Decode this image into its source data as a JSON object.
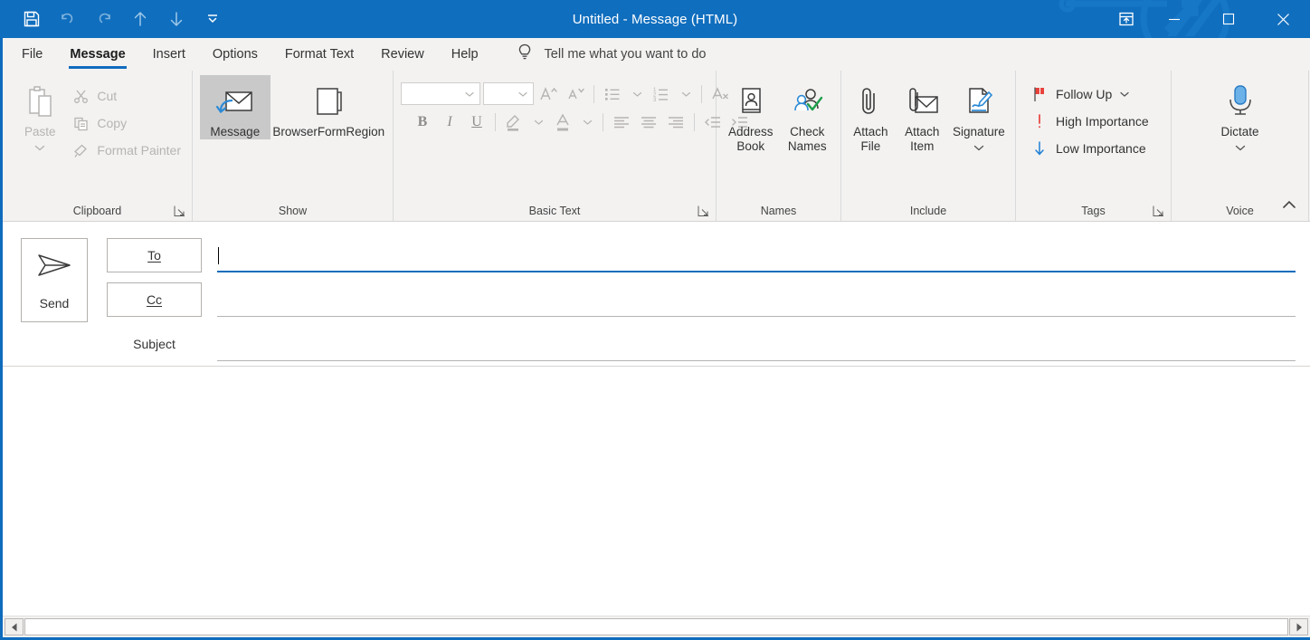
{
  "window": {
    "title": "Untitled  -  Message (HTML)",
    "accent_color": "#106ebe",
    "ribbon_bg": "#f3f2f1"
  },
  "quick_access": {
    "items": [
      {
        "name": "save-icon",
        "label": "Save",
        "disabled": false
      },
      {
        "name": "undo-icon",
        "label": "Undo",
        "disabled": true
      },
      {
        "name": "redo-icon",
        "label": "Redo",
        "disabled": true
      },
      {
        "name": "previous-item-icon",
        "label": "Previous Item",
        "disabled": false
      },
      {
        "name": "next-item-icon",
        "label": "Next Item",
        "disabled": false
      },
      {
        "name": "customize-quick-access-toolbar-icon",
        "label": "Customize Quick Access Toolbar",
        "disabled": false
      }
    ]
  },
  "window_controls": {
    "ribbon_display_options": "Ribbon Display Options",
    "minimize": "Minimize",
    "maximize": "Maximize",
    "close": "Close"
  },
  "tabs": [
    {
      "label": "File",
      "active": false
    },
    {
      "label": "Message",
      "active": true
    },
    {
      "label": "Insert",
      "active": false
    },
    {
      "label": "Options",
      "active": false
    },
    {
      "label": "Format Text",
      "active": false
    },
    {
      "label": "Review",
      "active": false
    },
    {
      "label": "Help",
      "active": false
    }
  ],
  "tell_me": {
    "icon": "lightbulb-icon",
    "text": "Tell me what you want to do"
  },
  "ribbon": {
    "collapse_label": "Collapse the Ribbon",
    "groups": {
      "clipboard": {
        "label": "Clipboard",
        "has_launcher": true,
        "paste": {
          "label": "Paste",
          "icon": "paste-icon",
          "disabled": true,
          "has_dropdown": true
        },
        "items": [
          {
            "label": "Cut",
            "icon": "scissors-icon",
            "disabled": true
          },
          {
            "label": "Copy",
            "icon": "copy-icon",
            "disabled": true
          },
          {
            "label": "Format Painter",
            "icon": "format-painter-icon",
            "disabled": true
          }
        ]
      },
      "show": {
        "label": "Show",
        "items": [
          {
            "label": "Message",
            "icon": "message-envelope-icon",
            "selected": true
          },
          {
            "label": "BrowserFormRegion",
            "icon": "form-region-icon",
            "selected": false
          }
        ]
      },
      "basic_text": {
        "label": "Basic Text",
        "has_launcher": true,
        "font_name": {
          "value": "",
          "placeholder": ""
        },
        "font_size": {
          "value": "",
          "placeholder": ""
        },
        "row1": [
          {
            "label": "Grow Font",
            "icon": "grow-font-icon"
          },
          {
            "label": "Shrink Font",
            "icon": "shrink-font-icon"
          },
          {
            "label": "Bullets",
            "icon": "bullets-icon",
            "has_dropdown": true
          },
          {
            "label": "Numbering",
            "icon": "numbering-icon",
            "has_dropdown": true
          },
          {
            "label": "Clear All Formatting",
            "icon": "clear-formatting-icon"
          }
        ],
        "row2": [
          {
            "label": "Bold",
            "icon": "bold-icon"
          },
          {
            "label": "Italic",
            "icon": "italic-icon"
          },
          {
            "label": "Underline",
            "icon": "underline-icon"
          },
          {
            "label": "Text Highlight Color",
            "icon": "highlight-icon",
            "has_dropdown": true
          },
          {
            "label": "Font Color",
            "icon": "font-color-icon",
            "has_dropdown": true
          },
          {
            "label": "Align Left",
            "icon": "align-left-icon"
          },
          {
            "label": "Center",
            "icon": "align-center-icon"
          },
          {
            "label": "Align Right",
            "icon": "align-right-icon"
          },
          {
            "label": "Decrease Indent",
            "icon": "decrease-indent-icon"
          },
          {
            "label": "Increase Indent",
            "icon": "increase-indent-icon"
          }
        ]
      },
      "names": {
        "label": "Names",
        "items": [
          {
            "label": "Address Book",
            "icon": "address-book-icon"
          },
          {
            "label": "Check Names",
            "icon": "check-names-icon"
          }
        ]
      },
      "include": {
        "label": "Include",
        "items": [
          {
            "label": "Attach File",
            "icon": "paperclip-icon",
            "has_dropdown": true
          },
          {
            "label": "Attach Item",
            "icon": "attach-item-icon",
            "has_dropdown": true
          },
          {
            "label": "Signature",
            "icon": "signature-icon",
            "has_dropdown": true
          }
        ]
      },
      "tags": {
        "label": "Tags",
        "has_launcher": true,
        "items": [
          {
            "label": "Follow Up",
            "icon": "flag-icon",
            "has_dropdown": true,
            "color": "#e8413a"
          },
          {
            "label": "High Importance",
            "icon": "exclamation-icon",
            "has_dropdown": false,
            "color": "#e8413a"
          },
          {
            "label": "Low Importance",
            "icon": "down-arrow-icon",
            "has_dropdown": false,
            "color": "#1e7fd4"
          }
        ]
      },
      "voice": {
        "label": "Voice",
        "dictate": {
          "label": "Dictate",
          "icon": "microphone-icon",
          "has_dropdown": true,
          "color": "#4a9ee0"
        }
      }
    }
  },
  "compose": {
    "send_button": {
      "label": "Send",
      "icon": "send-plane-icon"
    },
    "to": {
      "label": "To",
      "value": "",
      "focused": true
    },
    "cc": {
      "label": "Cc",
      "value": "",
      "focused": false
    },
    "subject": {
      "label": "Subject",
      "value": ""
    },
    "body": {
      "value": ""
    }
  },
  "scrollbar": {
    "left_arrow": "Scroll Left",
    "right_arrow": "Scroll Right"
  }
}
